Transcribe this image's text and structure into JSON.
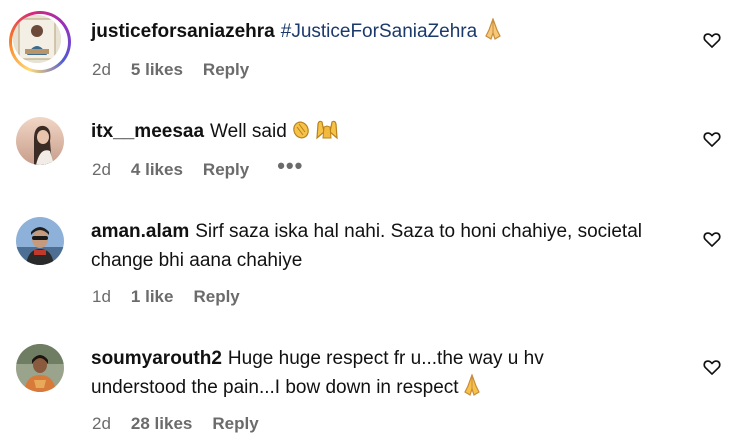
{
  "comments": [
    {
      "username": "justiceforsaniazehra",
      "text": "#JusticeForSaniaZehra",
      "time": "2d",
      "likes": "5 likes",
      "reply": "Reply",
      "avatar_icon": "profile-photo-icon",
      "has_story": true
    },
    {
      "username": "itx__meesaa",
      "text": "Well said",
      "time": "2d",
      "likes": "4 likes",
      "reply": "Reply",
      "more": "•••",
      "avatar_icon": "profile-photo-icon"
    },
    {
      "username": "aman.alam",
      "text_line1": "Sirf saza iska hal nahi. Saza to honi chahiye, societal",
      "text_line2": "change bhi aana chahiye",
      "time": "1d",
      "likes": "1 like",
      "reply": "Reply",
      "avatar_icon": "profile-photo-icon"
    },
    {
      "username": "soumyarouth2",
      "text_line1": "Huge huge respect fr u...the way u hv",
      "text_line2": "understood the pain...I bow down in respect",
      "time": "2d",
      "likes": "28 likes",
      "reply": "Reply",
      "avatar_icon": "profile-photo-icon"
    }
  ],
  "icons": {
    "like": "heart-outline-icon",
    "pray": "folded-hands-emoji",
    "clap": "clapping-hands-emoji",
    "raised": "raising-hands-emoji"
  },
  "colors": {
    "hashtag": "#1b3a6b",
    "meta": "#6b6b6b",
    "text": "#111111"
  }
}
